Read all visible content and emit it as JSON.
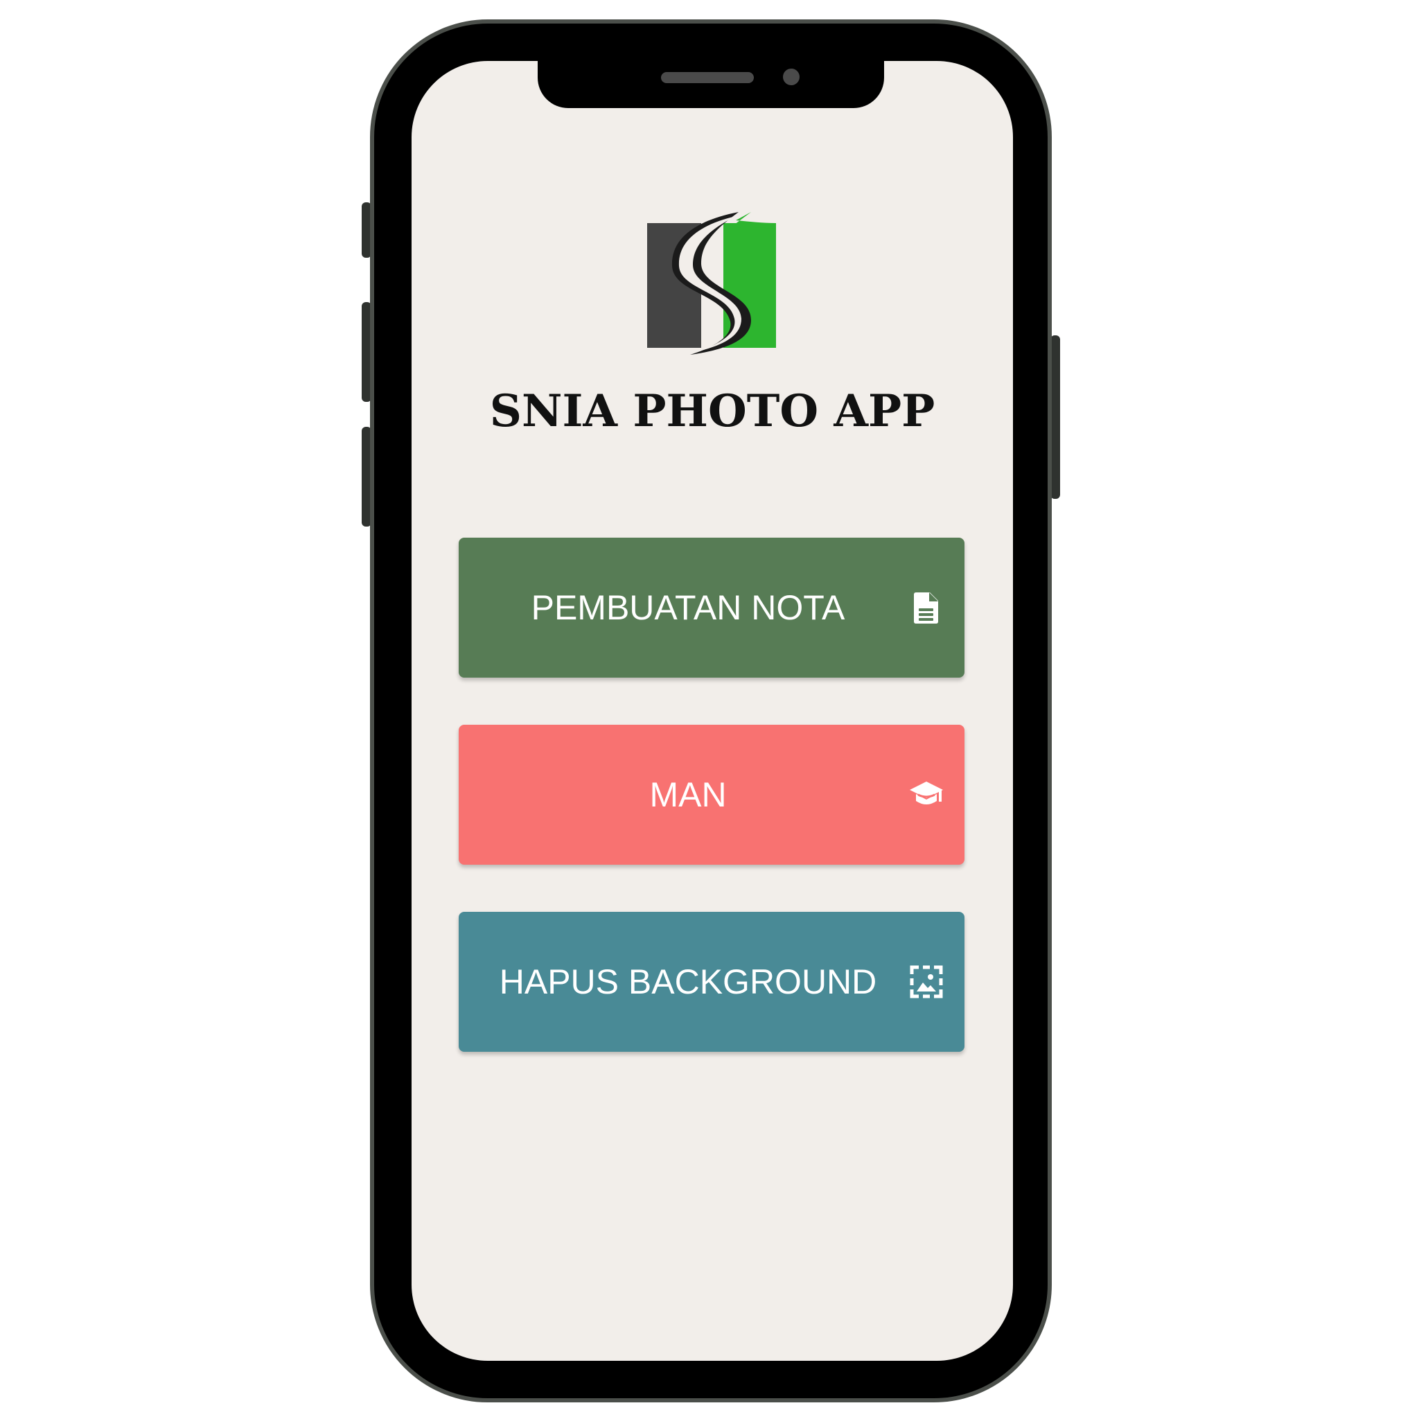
{
  "app": {
    "title": "SNIA PHOTO APP",
    "logo_icon": "snia-s-logo",
    "background_color": "#f2eeea"
  },
  "menu": [
    {
      "label": "PEMBUATAN NOTA",
      "icon": "document-icon",
      "color": "#577c55"
    },
    {
      "label": "MAN",
      "icon": "graduation-cap-icon",
      "color": "#f87271"
    },
    {
      "label": "HAPUS BACKGROUND",
      "icon": "image-frame-icon",
      "color": "#498a96"
    }
  ]
}
